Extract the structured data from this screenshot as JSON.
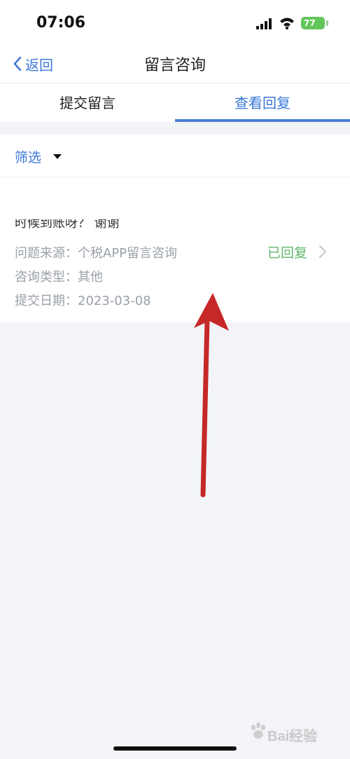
{
  "status_bar": {
    "time": "07:06",
    "battery": "77"
  },
  "nav": {
    "back_label": "返回",
    "title": "留言咨询"
  },
  "tabs": [
    {
      "label": "提交留言"
    },
    {
      "label": "查看回复"
    }
  ],
  "filter": {
    "label": "筛选"
  },
  "card": {
    "content_fragment": "时候到账呀？ 谢谢",
    "source_label": "问题来源：",
    "source_value": "个税APP留言咨询",
    "type_label": "咨询类型：",
    "type_value": "其他",
    "date_label": "提交日期：",
    "date_value": "2023-03-08",
    "status": "已回复"
  },
  "watermark": {
    "text": "Bai经验"
  },
  "colors": {
    "accent": "#3b78d8",
    "status_green": "#5fb86a",
    "arrow_red": "#c62828"
  }
}
